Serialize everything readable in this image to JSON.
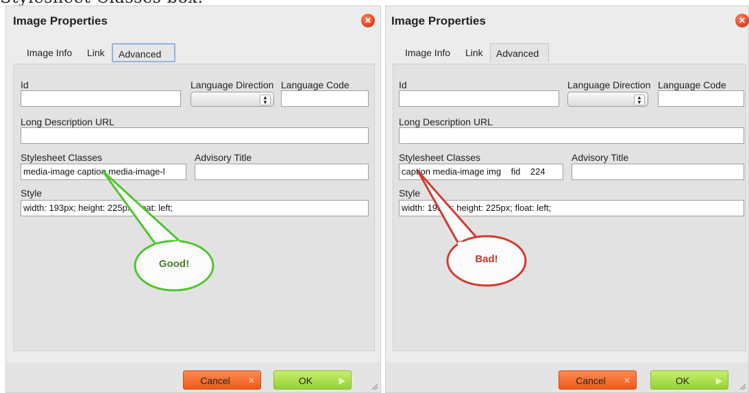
{
  "caption": "Stylesheet Classes box.",
  "left_dialog": {
    "title": "Image Properties",
    "tabs": [
      "Image Info",
      "Link",
      "Advanced"
    ],
    "id_label": "Id",
    "id_value": "",
    "lang_dir_label": "Language Direction",
    "lang_code_label": "Language Code",
    "lang_code_value": "",
    "long_desc_label": "Long Description URL",
    "long_desc_value": "",
    "stylesheet_label": "Stylesheet Classes",
    "stylesheet_value": "media-image caption media-image-l",
    "advisory_label": "Advisory Title",
    "advisory_value": "",
    "style_label": "Style",
    "style_value": "width: 193px; height: 225px; float: left;",
    "cancel_label": "Cancel",
    "ok_label": "OK",
    "callout_text": "Good!"
  },
  "right_dialog": {
    "title": "Image Properties",
    "tabs": [
      "Image Info",
      "Link",
      "Advanced"
    ],
    "id_label": "Id",
    "id_value": "",
    "lang_dir_label": "Language Direction",
    "lang_code_label": "Language Code",
    "lang_code_value": "",
    "long_desc_label": "Long Description URL",
    "long_desc_value": "",
    "stylesheet_label": "Stylesheet Classes",
    "stylesheet_value": "caption media-image img    fid    224",
    "advisory_label": "Advisory Title",
    "advisory_value": "",
    "style_label": "Style",
    "style_value": "width: 193px; height: 225px; float: left;",
    "cancel_label": "Cancel",
    "ok_label": "OK",
    "callout_text": "Bad!"
  },
  "colors": {
    "good": "#4cc62a",
    "good_text": "#4a7d2a",
    "bad": "#d33a2c",
    "bad_text": "#c0392b",
    "cancel": "#f05a18",
    "ok": "#94d233",
    "active_tab_border": "#8fb3d9"
  },
  "icons": {
    "close": "close-icon",
    "select": "select-arrows-icon",
    "cancel": "cancel-x-icon",
    "ok": "ok-arrow-icon",
    "resize": "resize-grip-icon"
  }
}
